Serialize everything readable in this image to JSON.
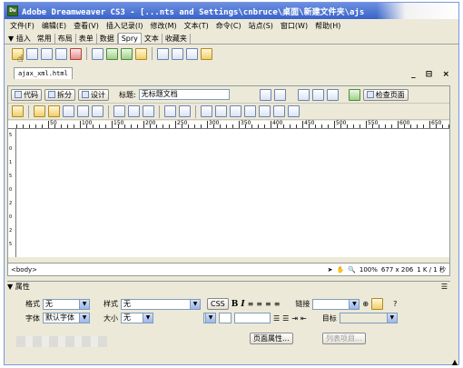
{
  "window": {
    "app_icon": "Dw",
    "title": "Adobe Dreamweaver CS3 - [...nts and Settings\\cnbruce\\桌面\\新建文件夹\\ajs"
  },
  "menu": [
    "文件(F)",
    "编辑(E)",
    "查看(V)",
    "插入记录(I)",
    "修改(M)",
    "文本(T)",
    "命令(C)",
    "站点(S)",
    "窗口(W)",
    "帮助(H)"
  ],
  "insert_bar": {
    "lead": "▼ 插入",
    "tabs": [
      "常用",
      "布局",
      "表单",
      "数据",
      "Spry",
      "文本",
      "收藏夹"
    ],
    "active_tab": "Spry",
    "icons": [
      "spry-xml-dataset-icon",
      "spry-region-icon",
      "spry-repeat-icon",
      "spry-repeat-list-icon",
      "spry-table-icon",
      "spry-validation-text-icon",
      "spry-validation-select-icon",
      "spry-validation-checkbox-icon",
      "spry-validation-textarea-icon",
      "spry-menubar-icon",
      "spry-tabbed-panels-icon",
      "spry-accordion-icon",
      "spry-collapsible-panel-icon"
    ]
  },
  "document": {
    "tab_label": "ajax_xml.html",
    "window_controls": "_ ⊟ ×",
    "view_buttons": {
      "code": "代码",
      "split": "拆分",
      "design": "设计"
    },
    "title_label": "标题:",
    "title_value": "无标题文档",
    "check_page": "检查页面",
    "ruler_marks": [
      "50",
      "100",
      "150",
      "200",
      "250",
      "300",
      "350",
      "400",
      "450",
      "500",
      "550",
      "600",
      "650"
    ],
    "vruler_marks": [
      "5",
      "0",
      "1",
      "5",
      "0",
      "2",
      "0",
      "2",
      "5"
    ],
    "status": {
      "tag": "<body>",
      "zoom": "100%",
      "size": "677 x 206",
      "weight": "1 K / 1 秒"
    }
  },
  "properties": {
    "header": "▼ 属性",
    "format_label": "格式",
    "format_value": "无",
    "style_label": "样式",
    "style_value": "无",
    "css_button": "CSS",
    "bold": "B",
    "italic": "I",
    "link_label": "链接",
    "font_label": "字体",
    "font_value": "默认字体",
    "size_label": "大小",
    "size_value": "无",
    "target_label": "目标",
    "page_props_button": "页面属性...",
    "list_item_button": "列表项目..."
  }
}
